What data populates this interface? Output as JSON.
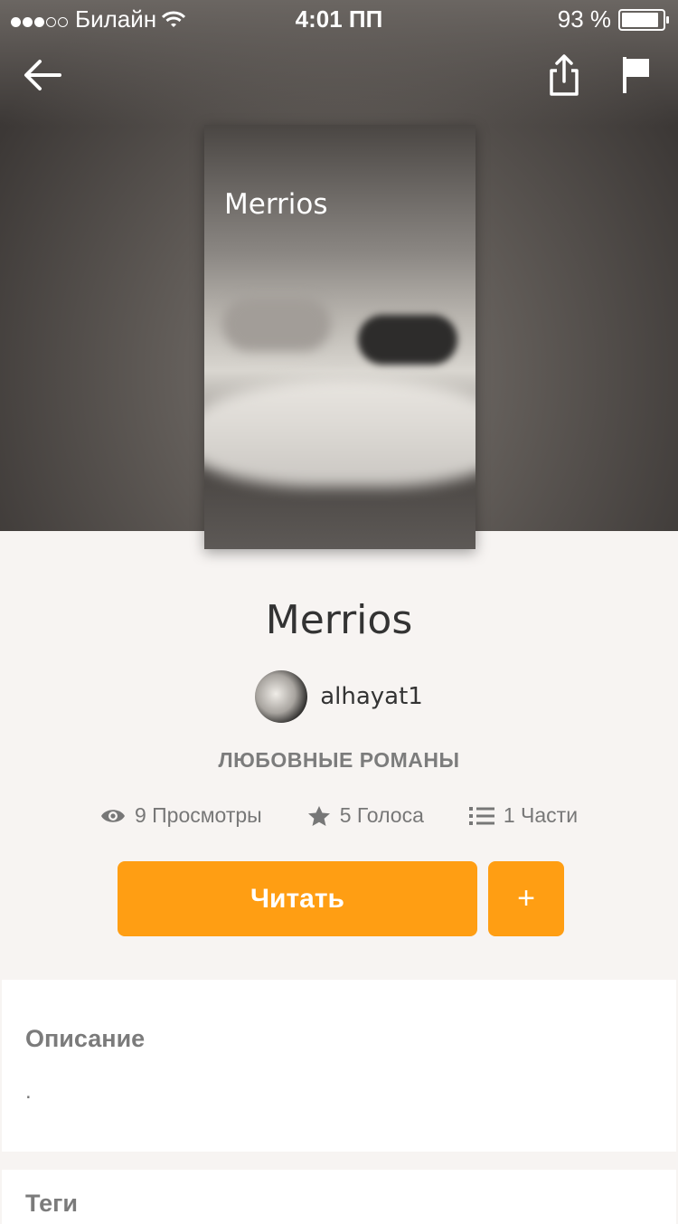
{
  "status_bar": {
    "carrier": "Билайн",
    "time": "4:01 ПП",
    "battery": "93 %"
  },
  "cover": {
    "title": "Merrios"
  },
  "book": {
    "title": "Merrios",
    "author": "alhayat1",
    "genre": "ЛЮБОВНЫЕ РОМАНЫ"
  },
  "stats": {
    "views_count": "9",
    "views_label": "Просмотры",
    "votes_count": "5",
    "votes_label": "Голоса",
    "parts_count": "1",
    "parts_label": "Части"
  },
  "actions": {
    "read_label": "Читать",
    "add_label": "+"
  },
  "description": {
    "heading": "Описание",
    "text": "."
  },
  "tags": {
    "heading": "Теги"
  },
  "colors": {
    "accent": "#ff9e13"
  }
}
